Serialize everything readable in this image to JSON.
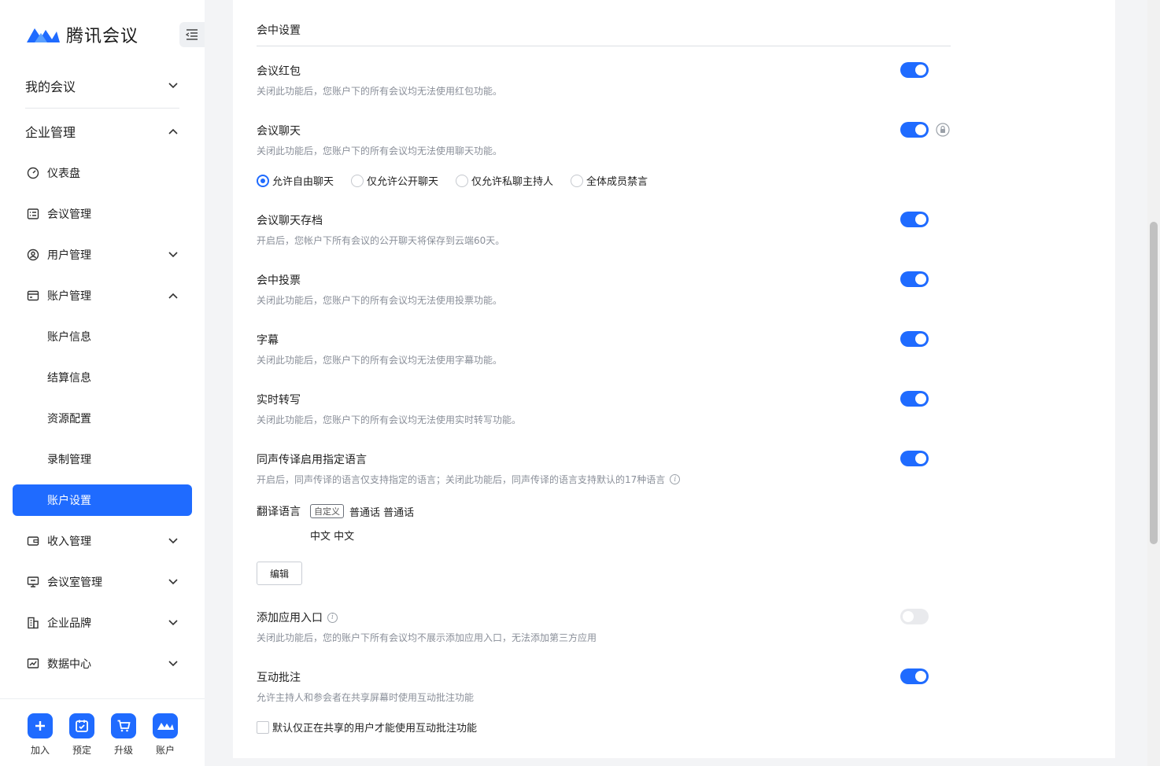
{
  "app": {
    "logo_text": "腾讯会议",
    "brand_color": "#1f6bff"
  },
  "sidebar": {
    "my_meetings": "我的会议",
    "enterprise_mgmt": "企业管理",
    "items": [
      {
        "label": "仪表盘",
        "icon": "dashboard-icon"
      },
      {
        "label": "会议管理",
        "icon": "list-icon"
      },
      {
        "label": "用户管理",
        "icon": "user-icon"
      },
      {
        "label": "账户管理",
        "icon": "card-icon"
      },
      {
        "label": "收入管理",
        "icon": "wallet-icon"
      },
      {
        "label": "会议室管理",
        "icon": "room-icon"
      },
      {
        "label": "企业品牌",
        "icon": "building-icon"
      },
      {
        "label": "数据中心",
        "icon": "chart-icon"
      }
    ],
    "account_sub": [
      "账户信息",
      "结算信息",
      "资源配置",
      "录制管理"
    ],
    "active": "账户设置"
  },
  "bottom_bar": [
    "加入",
    "预定",
    "升级",
    "账户"
  ],
  "section": {
    "title": "会中设置"
  },
  "settings": {
    "red_packet": {
      "title": "会议红包",
      "desc": "关闭此功能后，您账户下的所有会议均无法使用红包功能。",
      "on": true
    },
    "chat": {
      "title": "会议聊天",
      "desc": "关闭此功能后，您账户下的所有会议均无法使用聊天功能。",
      "on": true
    },
    "chat_options": [
      "允许自由聊天",
      "仅允许公开聊天",
      "仅允许私聊主持人",
      "全体成员禁言"
    ],
    "chat_archive": {
      "title": "会议聊天存档",
      "desc": "开启后，您帐户下所有会议的公开聊天将保存到云端60天。",
      "on": true
    },
    "voting": {
      "title": "会中投票",
      "desc": "关闭此功能后，您账户下的所有会议均无法使用投票功能。",
      "on": true
    },
    "subtitles": {
      "title": "字幕",
      "desc": "关闭此功能后，您账户下的所有会议均无法使用字幕功能。",
      "on": true
    },
    "transcription": {
      "title": "实时转写",
      "desc": "关闭此功能后，您账户下的所有会议均无法使用实时转写功能。",
      "on": true
    },
    "interpretation": {
      "title": "同声传译启用指定语言",
      "desc": "开启后，同声传译的语言仅支持指定的语言；关闭此功能后，同声传译的语言支持默认的17种语言",
      "on": true
    },
    "translation": {
      "label": "翻译语言",
      "tag": "自定义",
      "line1": "普通话 普通话",
      "line2": "中文 中文",
      "edit": "编辑"
    },
    "app_entry": {
      "title": "添加应用入口",
      "desc": "关闭此功能后，您的账户下所有会议均不展示添加应用入口，无法添加第三方应用",
      "on": false
    },
    "annotation": {
      "title": "互动批注",
      "desc": "允许主持人和参会者在共享屏幕时使用互动批注功能",
      "on": true
    },
    "annotation_checkbox": "默认仅正在共享的用户才能使用互动批注功能"
  }
}
